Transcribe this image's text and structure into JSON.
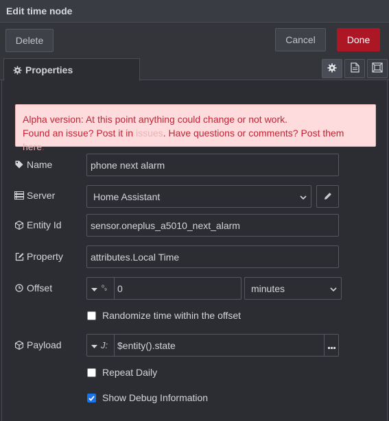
{
  "window": {
    "title": "Edit time node"
  },
  "toolbar": {
    "delete_label": "Delete",
    "cancel_label": "Cancel",
    "done_label": "Done"
  },
  "tabs": {
    "properties_label": "Properties"
  },
  "alert": {
    "line1": "Alpha version: At this point anything could change or not work.",
    "line2_prefix": "Found an issue? Post it in ",
    "issues_link": "issues",
    "line2_middle": ". Have questions or comments? Post them ",
    "here_link": "here",
    "line2_suffix": "."
  },
  "form": {
    "name": {
      "label": "Name",
      "value": "phone next alarm"
    },
    "server": {
      "label": "Server",
      "value": "Home Assistant"
    },
    "entity_id": {
      "label": "Entity Id",
      "value": "sensor.oneplus_a5010_next_alarm"
    },
    "property": {
      "label": "Property",
      "value": "attributes.Local Time"
    },
    "offset": {
      "label": "Offset",
      "type_icon": "⁰₉",
      "value": "0",
      "unit": "minutes"
    },
    "randomize": {
      "label": "Randomize time within the offset",
      "checked": false
    },
    "payload": {
      "label": "Payload",
      "type_icon": "J:",
      "value": "$entity().state"
    },
    "repeat_daily": {
      "label": "Repeat Daily",
      "checked": false
    },
    "show_debug": {
      "label": "Show Debug Information",
      "checked": true
    }
  },
  "colors": {
    "accent": "#ad1625",
    "background": "#2b2d33",
    "alert_bg": "#fedcdd",
    "alert_text": "#c22334",
    "checkbox": "#1a73e8"
  },
  "icons": {
    "properties": "gear-icon",
    "description": "file-icon",
    "appearance": "frame-icon",
    "name": "tag-icon",
    "server": "server-icon",
    "edit": "pencil-icon",
    "entity": "cube-icon",
    "property": "edit-square-icon",
    "offset": "clock-icon",
    "payload": "cube-icon"
  }
}
